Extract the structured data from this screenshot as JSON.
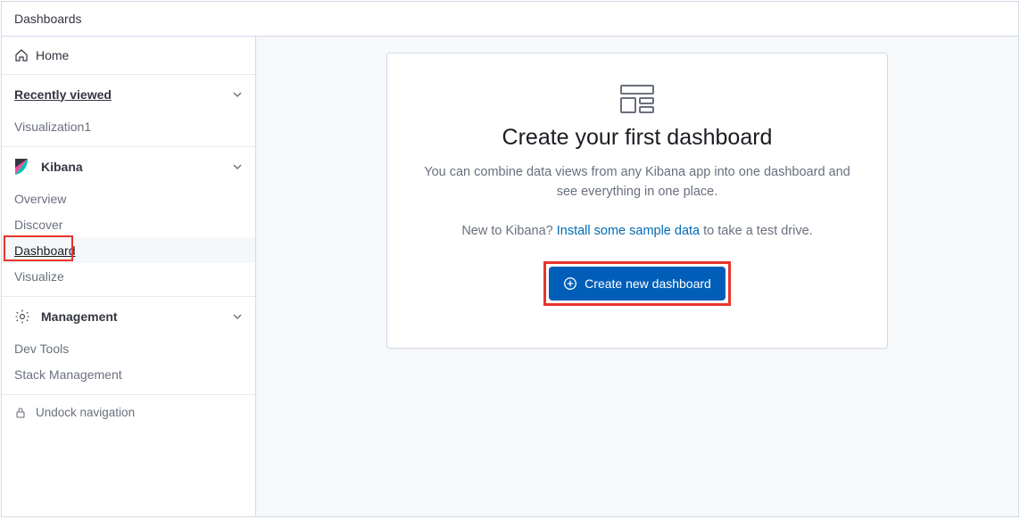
{
  "topbar": {
    "title": "Dashboards"
  },
  "sidebar": {
    "home_label": "Home",
    "recently_viewed": {
      "label": "Recently viewed",
      "items": [
        "Visualization1"
      ]
    },
    "kibana": {
      "label": "Kibana",
      "items": [
        "Overview",
        "Discover",
        "Dashboard",
        "Visualize"
      ],
      "active_index": 2
    },
    "management": {
      "label": "Management",
      "items": [
        "Dev Tools",
        "Stack Management"
      ]
    },
    "undock_label": "Undock navigation"
  },
  "main": {
    "title": "Create your first dashboard",
    "description": "You can combine data views from any Kibana app into one dashboard and see everything in one place.",
    "sample_prefix": "New to Kibana? ",
    "sample_link": "Install some sample data",
    "sample_suffix": " to take a test drive.",
    "create_button": "Create new dashboard"
  },
  "icons": {
    "home": "home-icon",
    "kibana": "kibana-logo",
    "management": "gear-icon",
    "lock": "lock-icon",
    "dashboard": "dashboard-icon",
    "plus": "plus-circle-icon",
    "chevron": "chevron-down-icon"
  }
}
